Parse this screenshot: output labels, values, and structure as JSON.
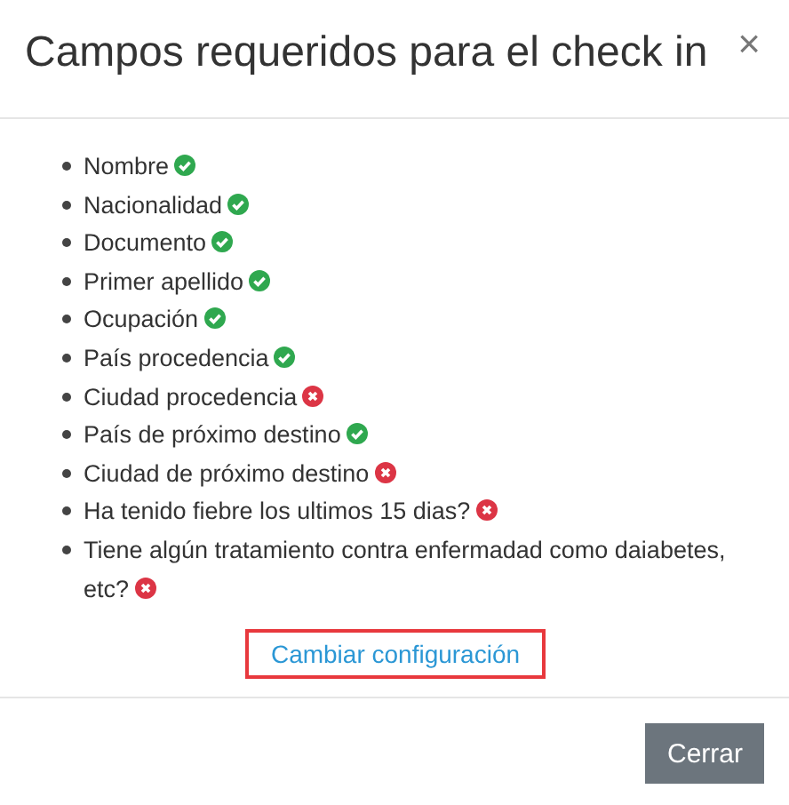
{
  "dialog": {
    "title": "Campos requeridos para el check in",
    "close": "×"
  },
  "fields": [
    {
      "label": "Nombre",
      "ok": true
    },
    {
      "label": "Nacionalidad",
      "ok": true
    },
    {
      "label": "Documento",
      "ok": true
    },
    {
      "label": "Primer apellido",
      "ok": true
    },
    {
      "label": "Ocupación",
      "ok": true
    },
    {
      "label": "País procedencia",
      "ok": true
    },
    {
      "label": "Ciudad procedencia",
      "ok": false
    },
    {
      "label": "País de próximo destino",
      "ok": true
    },
    {
      "label": "Ciudad de próximo destino",
      "ok": false
    },
    {
      "label": "Ha tenido fiebre los ultimos 15 dias?",
      "ok": false
    },
    {
      "label": "Tiene algún tratamiento contra enfermadad como daiabetes, etc?",
      "ok": false
    }
  ],
  "link": {
    "label": "Cambiar configuración",
    "highlighted": true
  },
  "buttons": [
    {
      "label": "Cerrar"
    }
  ]
}
